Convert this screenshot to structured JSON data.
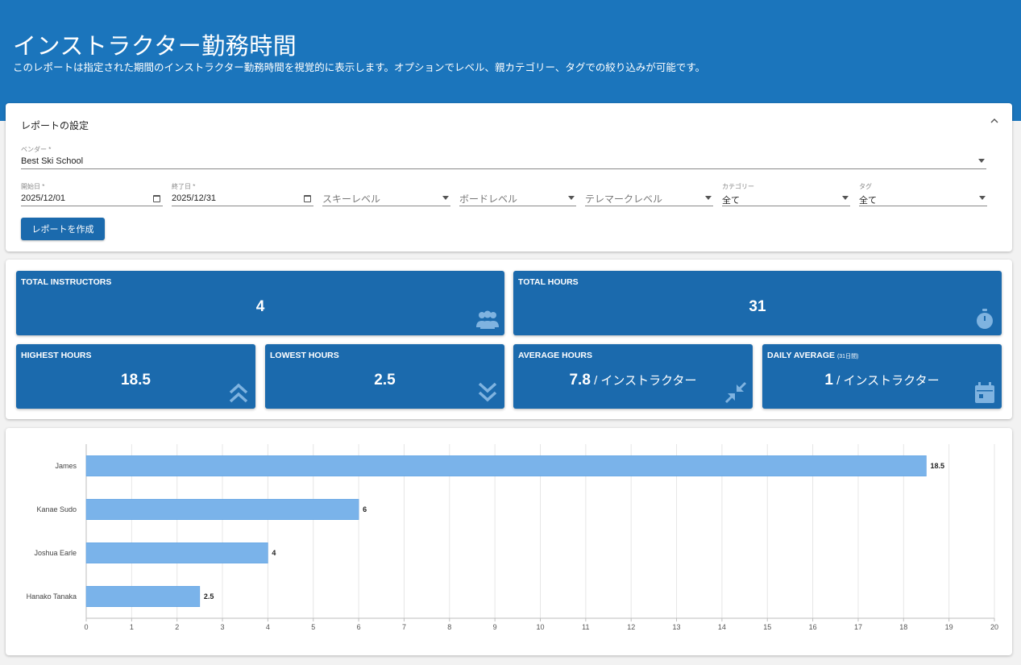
{
  "header": {
    "title": "インストラクター勤務時間",
    "subtitle": "このレポートは指定された期間のインストラクター勤務時間を視覚的に表示します。オプションでレベル、親カテゴリー、タグでの絞り込みが可能です。"
  },
  "settings": {
    "title": "レポートの設定",
    "vendor": {
      "label": "ベンダー *",
      "value": "Best Ski School"
    },
    "start_date": {
      "label": "開始日 *",
      "value": "2025/12/01"
    },
    "end_date": {
      "label": "終了日 *",
      "value": "2025/12/31"
    },
    "ski_level": {
      "placeholder": "スキーレベル"
    },
    "board_level": {
      "placeholder": "ボードレベル"
    },
    "telemark_level": {
      "placeholder": "テレマークレベル"
    },
    "category": {
      "label": "カテゴリー",
      "value": "全て"
    },
    "tag": {
      "label": "タグ",
      "value": "全て"
    },
    "create_button": "レポートを作成"
  },
  "stats": {
    "total_instructors": {
      "label": "TOTAL INSTRUCTORS",
      "value": "4",
      "icon": "group-icon"
    },
    "total_hours": {
      "label": "TOTAL HOURS",
      "value": "31",
      "icon": "stopwatch-icon"
    },
    "highest_hours": {
      "label": "HIGHEST HOURS",
      "value": "18.5",
      "icon": "double-chevron-up-icon"
    },
    "lowest_hours": {
      "label": "LOWEST HOURS",
      "value": "2.5",
      "icon": "double-chevron-down-icon"
    },
    "average_hours": {
      "label": "AVERAGE HOURS",
      "value": "7.8",
      "unit": " / インストラクター",
      "icon": "compress-arrows-icon"
    },
    "daily_average": {
      "label": "DAILY AVERAGE",
      "label_note": "(31日間)",
      "value": "1",
      "unit": " / インストラクター",
      "icon": "calendar-icon"
    }
  },
  "colors": {
    "header": "#1b75bc",
    "stat_card": "#1b6aad",
    "bar": "#7ab3ea"
  },
  "chart_data": {
    "type": "bar",
    "orientation": "horizontal",
    "categories": [
      "James",
      "Kanae Sudo",
      "Joshua Earle",
      "Hanako Tanaka"
    ],
    "values": [
      18.5,
      6,
      4,
      2.5
    ],
    "value_labels": [
      "18.5",
      "6",
      "4",
      "2.5"
    ],
    "xlim": [
      0,
      20
    ],
    "x_ticks": [
      "0",
      "1",
      "2",
      "3",
      "4",
      "5",
      "6",
      "7",
      "8",
      "9",
      "10",
      "11",
      "12",
      "13",
      "14",
      "15",
      "16",
      "17",
      "18",
      "19",
      "20"
    ],
    "grid": true
  }
}
